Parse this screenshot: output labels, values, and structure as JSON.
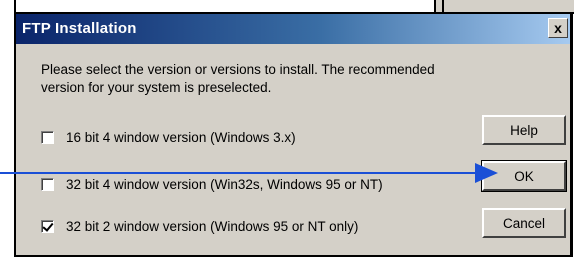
{
  "dialog": {
    "title": "FTP Installation",
    "close_glyph": "x",
    "prompt": "Please select the version or versions to install. The recommended version for your system is preselected.",
    "options": [
      {
        "label": "16 bit 4 window version (Windows 3.x)",
        "checked": false
      },
      {
        "label": "32 bit 4 window version (Win32s, Windows 95 or NT)",
        "checked": false
      },
      {
        "label": "32 bit 2 window version (Windows 95 or NT only)",
        "checked": true
      }
    ],
    "buttons": {
      "help": "Help",
      "ok": "OK",
      "cancel": "Cancel"
    }
  },
  "colors": {
    "titlebar_start": "#0a246a",
    "titlebar_end": "#a6caf0",
    "face": "#d4d0c8",
    "annotation_arrow": "#1a4fd6"
  },
  "icons": [
    "close-icon",
    "arrow-annotation"
  ]
}
